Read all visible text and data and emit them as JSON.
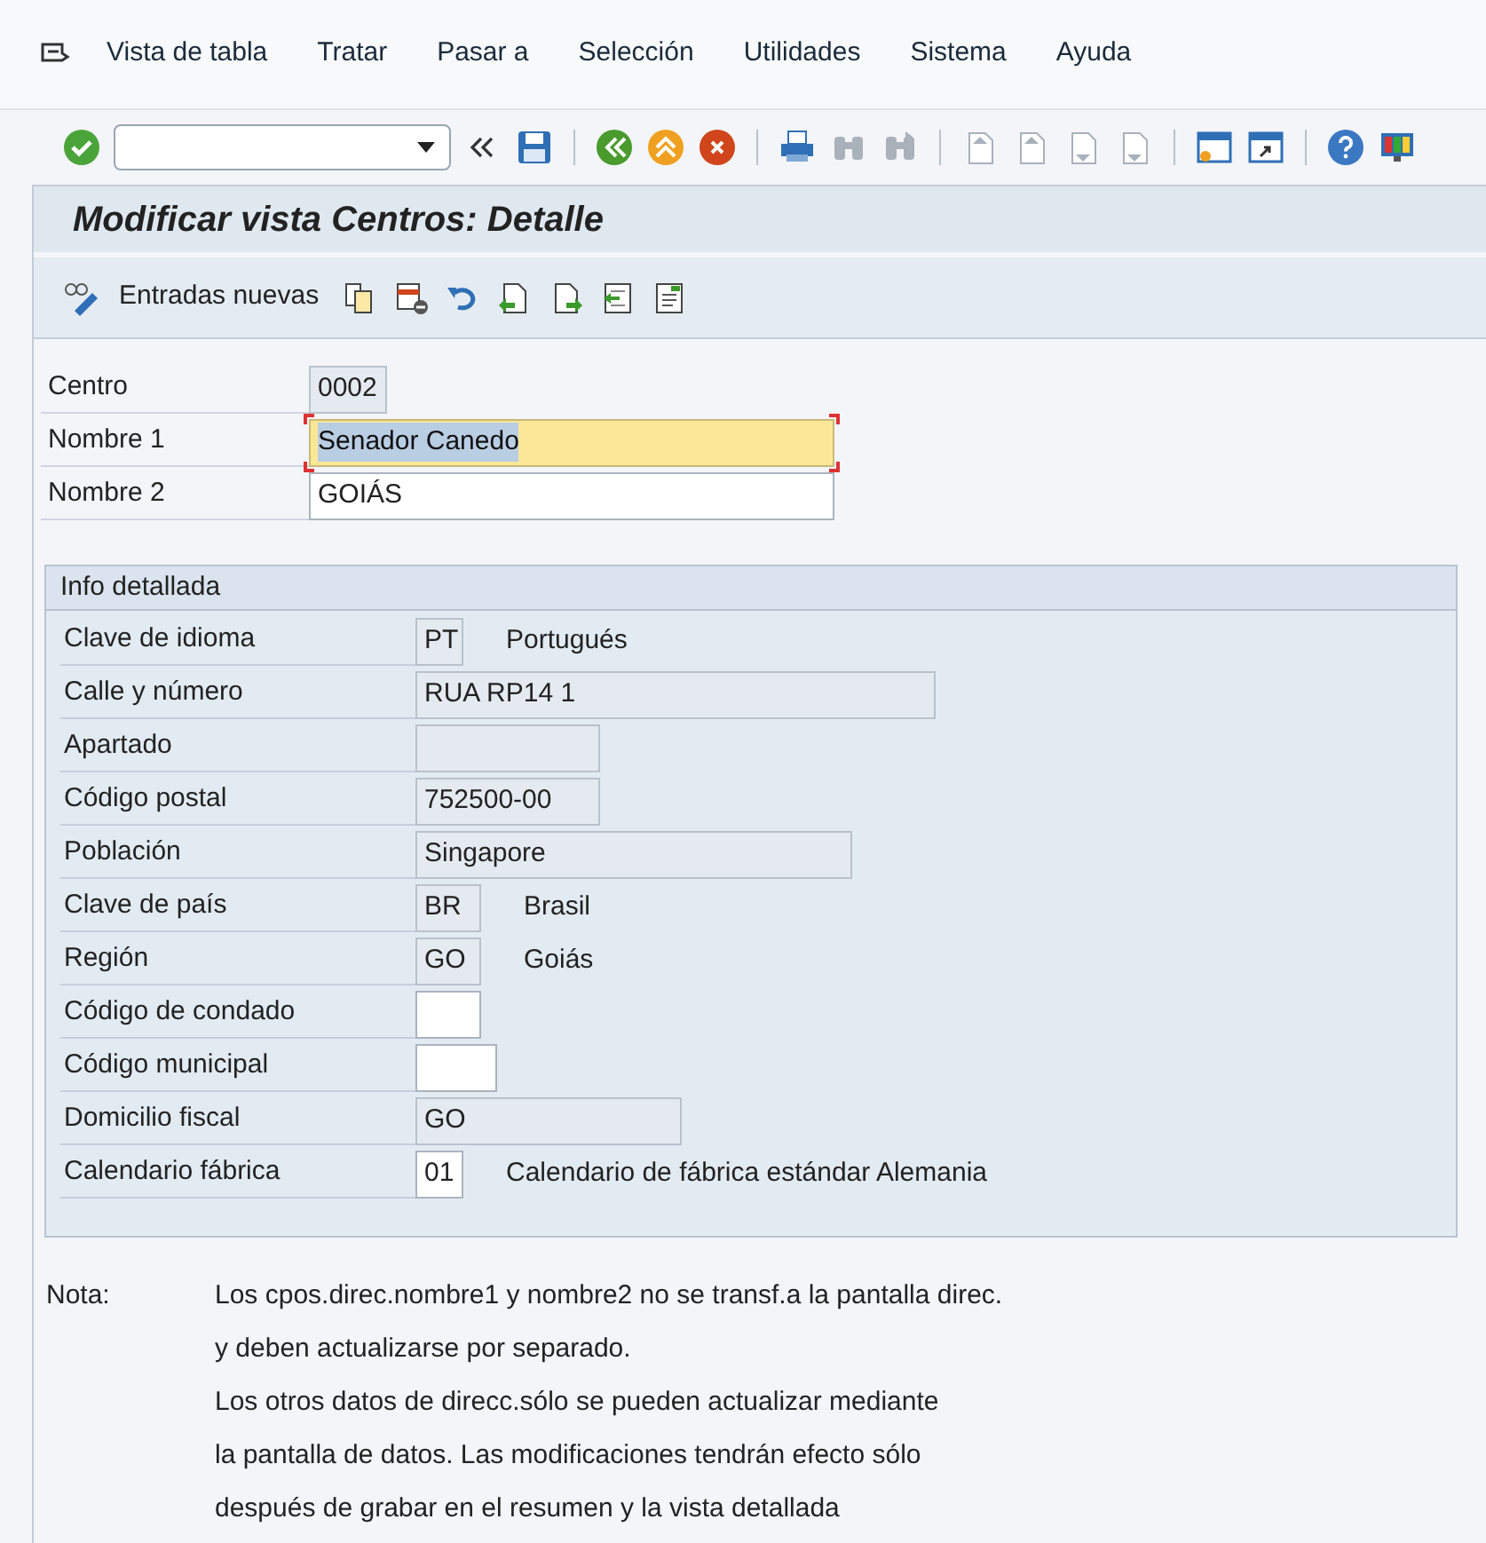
{
  "menu_bar": {
    "items": [
      "Vista de tabla",
      "Tratar",
      "Pasar a",
      "Selección",
      "Utilidades",
      "Sistema",
      "Ayuda"
    ]
  },
  "toolbar": {
    "buttons": [
      {
        "kind": "enter",
        "disabled": false
      },
      {
        "kind": "command",
        "disabled": false
      },
      {
        "kind": "collapse",
        "disabled": false
      },
      {
        "kind": "save",
        "disabled": false
      },
      {
        "kind": "sep"
      },
      {
        "kind": "back",
        "disabled": false
      },
      {
        "kind": "exit",
        "disabled": false
      },
      {
        "kind": "cancel",
        "disabled": false
      },
      {
        "kind": "sep"
      },
      {
        "kind": "print",
        "disabled": false
      },
      {
        "kind": "find",
        "disabled": true
      },
      {
        "kind": "findnext",
        "disabled": true
      },
      {
        "kind": "sep"
      },
      {
        "kind": "first",
        "disabled": true
      },
      {
        "kind": "prev",
        "disabled": true
      },
      {
        "kind": "next",
        "disabled": true
      },
      {
        "kind": "last",
        "disabled": true
      },
      {
        "kind": "sep"
      },
      {
        "kind": "session",
        "disabled": false
      },
      {
        "kind": "shortcut",
        "disabled": false
      },
      {
        "kind": "sep"
      },
      {
        "kind": "help",
        "disabled": false
      },
      {
        "kind": "layout",
        "disabled": false
      }
    ]
  },
  "title": "Modificar vista Centros: Detalle",
  "app_toolbar": {
    "new_entries": "Entradas nuevas",
    "icons": [
      {
        "kind": "copy"
      },
      {
        "kind": "delete"
      },
      {
        "kind": "undo"
      },
      {
        "kind": "prev"
      },
      {
        "kind": "next"
      },
      {
        "kind": "select"
      },
      {
        "kind": "info"
      }
    ]
  },
  "header_fields": [
    {
      "label": "Centro",
      "value": "0002",
      "editable": false,
      "focused": false
    },
    {
      "label": "Nombre 1",
      "value": "Senador Canedo",
      "editable": true,
      "focused": true
    },
    {
      "label": "Nombre 2",
      "value": "GOIÁS",
      "editable": true,
      "focused": false
    }
  ],
  "group": {
    "title": "Info detallada",
    "fields": [
      {
        "label": "Clave de idioma",
        "value": "PT",
        "editable": false,
        "description": "Portugués"
      },
      {
        "label": "Calle y número",
        "value": "RUA RP14 1",
        "editable": false
      },
      {
        "label": "Apartado",
        "editable": false
      },
      {
        "label": "Código postal",
        "value": "752500-00",
        "editable": false
      },
      {
        "label": "Población",
        "value": "Singapore",
        "editable": false
      },
      {
        "label": "Clave de país",
        "value": "BR",
        "editable": false,
        "description": "Brasil"
      },
      {
        "label": "Región",
        "value": "GO",
        "editable": false,
        "description": "Goiás"
      },
      {
        "label": "Código de condado",
        "editable": true
      },
      {
        "label": "Código municipal",
        "editable": true
      },
      {
        "label": "Domicilio fiscal",
        "value": "GO",
        "editable": false
      },
      {
        "label": "Calendario fábrica",
        "value": "01",
        "editable": true,
        "description": "Calendario de fábrica estándar Alemania"
      }
    ]
  },
  "note": {
    "label": "Nota:",
    "lines": [
      "Los cpos.direc.nombre1 y nombre2 no se transf.a la pantalla direc.",
      "y deben actualizarse por separado.",
      "Los otros datos de direcc.sólo se pueden actualizar mediante",
      "la pantalla de datos. Las modificaciones tendrán efecto sólo",
      "después de grabar en el resumen y la vista detallada"
    ]
  }
}
